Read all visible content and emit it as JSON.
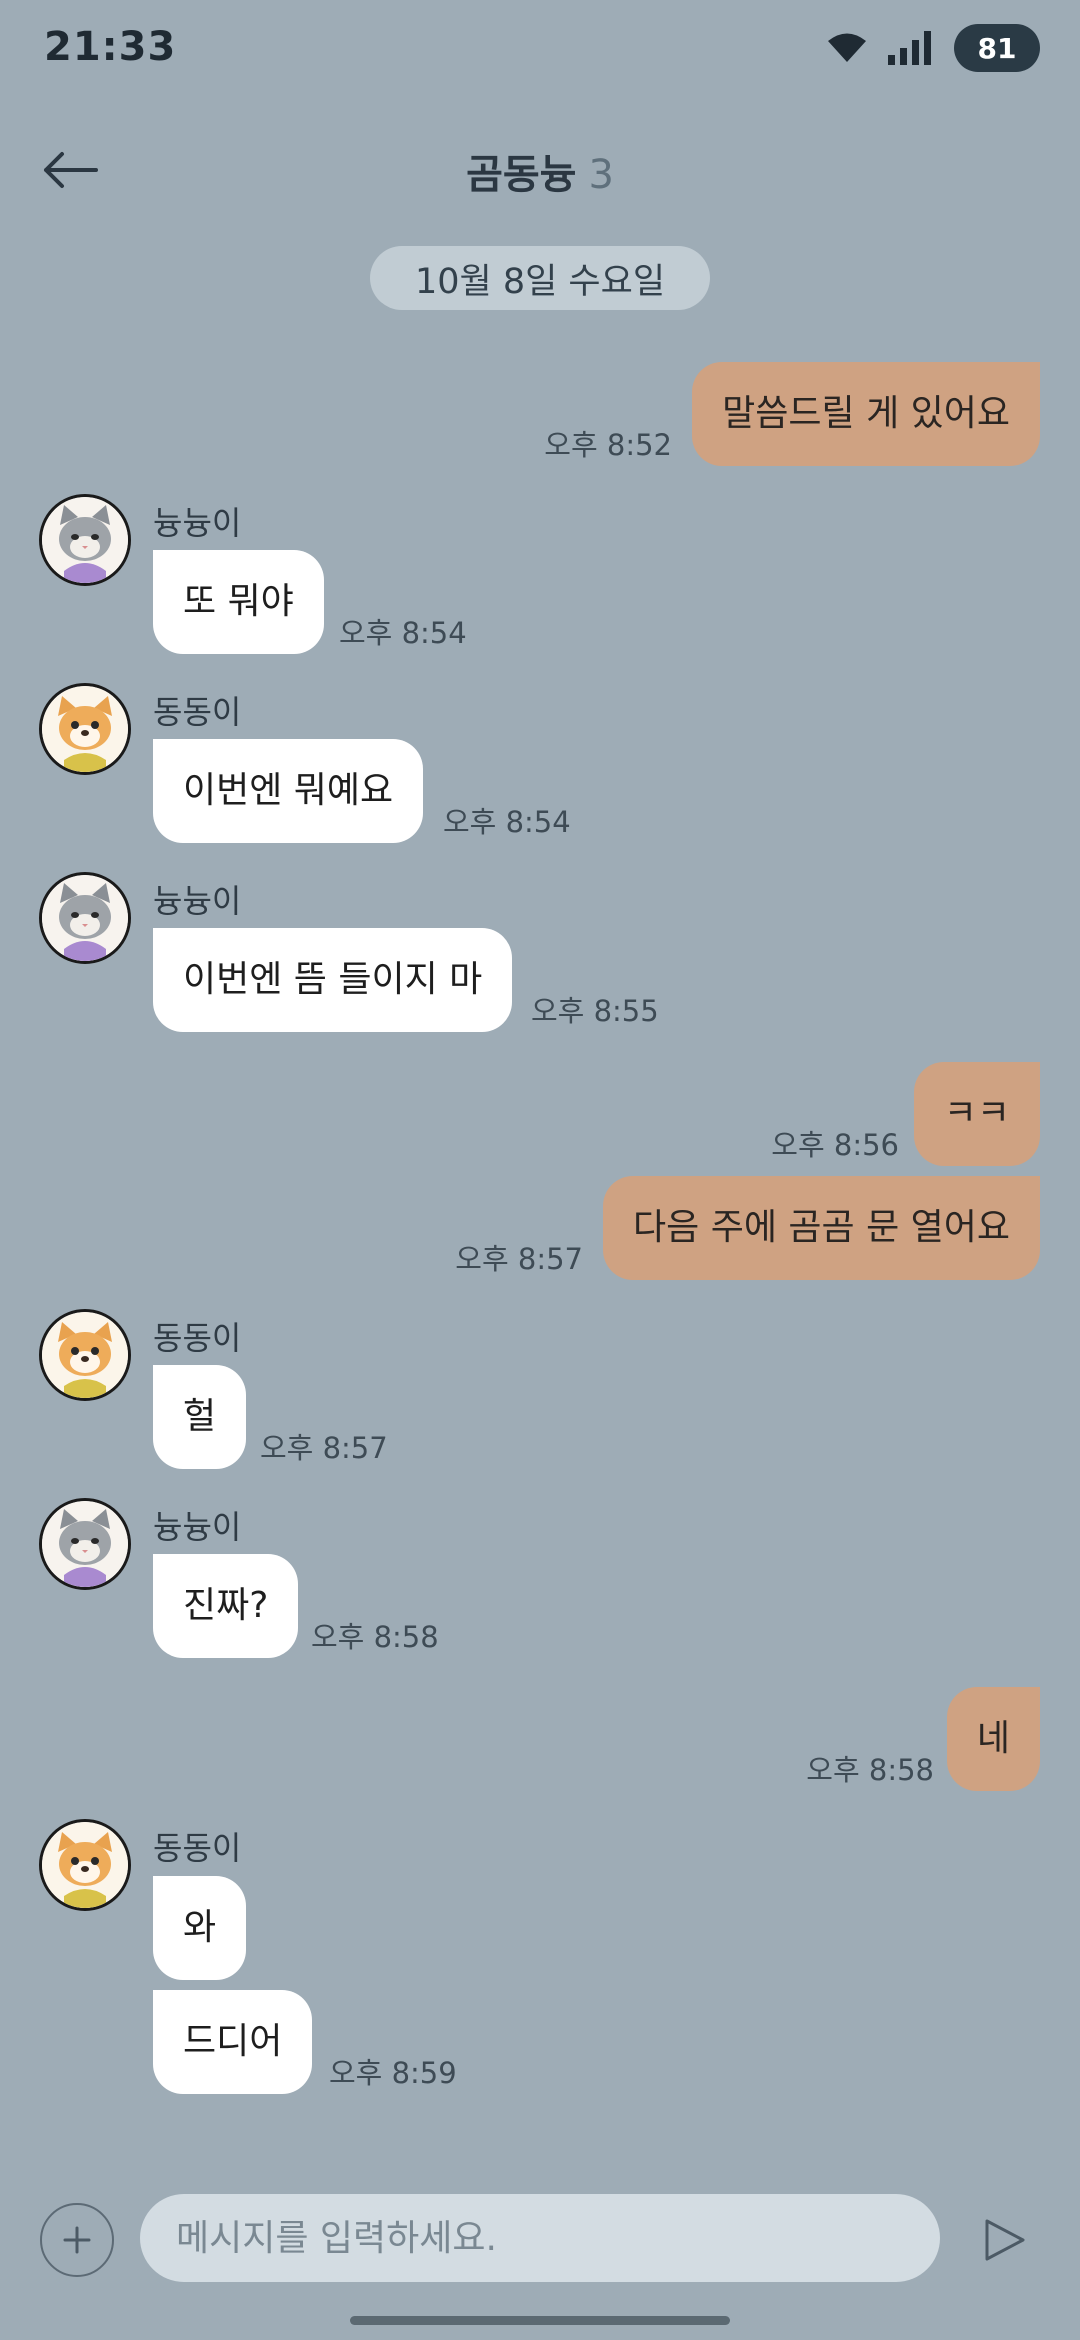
{
  "status_bar": {
    "time": "21:33",
    "battery": "81"
  },
  "header": {
    "title": "곰동늉",
    "member_count": "3"
  },
  "date_divider": "10월 8일 수요일",
  "messages": [
    {
      "id": 0,
      "direction": "out",
      "text": "말씀드릴 게 있어요",
      "time": "오후 8:52"
    },
    {
      "id": 1,
      "direction": "in",
      "sender": "늉늉이",
      "avatar": "cat-avatar",
      "text": "또 뭐야",
      "time": "오후 8:54"
    },
    {
      "id": 2,
      "direction": "in",
      "sender": "동동이",
      "avatar": "dog-avatar",
      "text": "이번엔 뭐예요",
      "time": "오후 8:54"
    },
    {
      "id": 3,
      "direction": "in",
      "sender": "늉늉이",
      "avatar": "cat-avatar",
      "text": "이번엔 뜸 들이지 마",
      "time": "오후 8:55"
    },
    {
      "id": 4,
      "direction": "out",
      "text": "ㅋㅋ",
      "time": "오후 8:56"
    },
    {
      "id": 5,
      "direction": "out",
      "text": "다음 주에 곰곰 문 열어요",
      "time": "오후 8:57"
    },
    {
      "id": 6,
      "direction": "in",
      "sender": "동동이",
      "avatar": "dog-avatar",
      "text": "헐",
      "time": "오후 8:57"
    },
    {
      "id": 7,
      "direction": "in",
      "sender": "늉늉이",
      "avatar": "cat-avatar",
      "text": "진짜?",
      "time": "오후 8:58"
    },
    {
      "id": 8,
      "direction": "out",
      "text": "네",
      "time": "오후 8:58"
    },
    {
      "id": 9,
      "direction": "in",
      "sender": "동동이",
      "avatar": "dog-avatar",
      "text": "와",
      "time": ""
    },
    {
      "id": 10,
      "direction": "in",
      "text": "드디어",
      "time": "오후 8:59"
    }
  ],
  "input": {
    "placeholder": "메시지를 입력하세요."
  },
  "icons": {
    "back": "back-arrow-icon",
    "add": "plus-icon",
    "send": "send-icon"
  },
  "colors": {
    "background": "#9eacb6",
    "outgoing_bubble": "#cfa282",
    "incoming_bubble": "#ffffff"
  }
}
